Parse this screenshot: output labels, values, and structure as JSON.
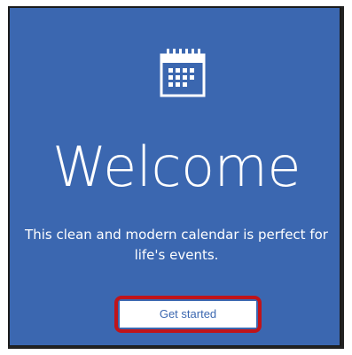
{
  "welcome": {
    "app_icon": "calendar-icon",
    "title": "Welcome",
    "subtitle": "This clean and modern calendar is perfect for life's events.",
    "button_label": "Get started"
  },
  "colors": {
    "background": "#3b67b0",
    "text": "#ffffff",
    "button_bg": "#ffffff",
    "button_text": "#3b67b0",
    "highlight": "#c0141a"
  }
}
